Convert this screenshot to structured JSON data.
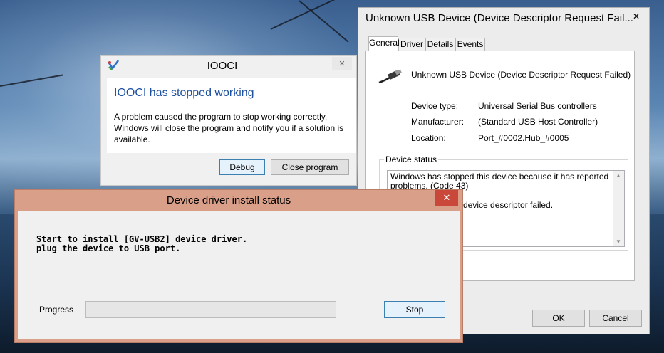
{
  "usb_props": {
    "title": "Unknown USB Device (Device Descriptor Request Fail...",
    "close_glyph": "✕",
    "tabs": [
      "General",
      "Driver",
      "Details",
      "Events"
    ],
    "device_name": "Unknown USB Device (Device Descriptor Request Failed)",
    "fields": [
      {
        "label": "Device type:",
        "value": "Universal Serial Bus controllers"
      },
      {
        "label": "Manufacturer:",
        "value": "(Standard USB Host Controller)"
      },
      {
        "label": "Location:",
        "value": "Port_#0002.Hub_#0005"
      }
    ],
    "status_label": "Device status",
    "status_text": "Windows has stopped this device because it has reported problems. (Code 43)",
    "status_hidden_tail": "device descriptor failed.",
    "ok_label": "OK",
    "cancel_label": "Cancel"
  },
  "iooci": {
    "title": "IOOCI",
    "close_glyph": "✕",
    "heading": "IOOCI has stopped working",
    "message": "A problem caused the program to stop working correctly. Windows will close the program and notify you if a solution is available.",
    "debug_label": "Debug",
    "close_program_label": "Close program"
  },
  "driver_install": {
    "title": "Device driver install status",
    "close_glyph": "✕",
    "line1": "Start to install [GV-USB2] device driver.",
    "line2": "plug the device to USB port.",
    "progress_label": "Progress",
    "progress_fraction": 0,
    "stop_label": "Stop"
  },
  "colors": {
    "heading_blue": "#1e50a0",
    "driver_frame": "#d99f88",
    "close_red": "#c9483a"
  }
}
